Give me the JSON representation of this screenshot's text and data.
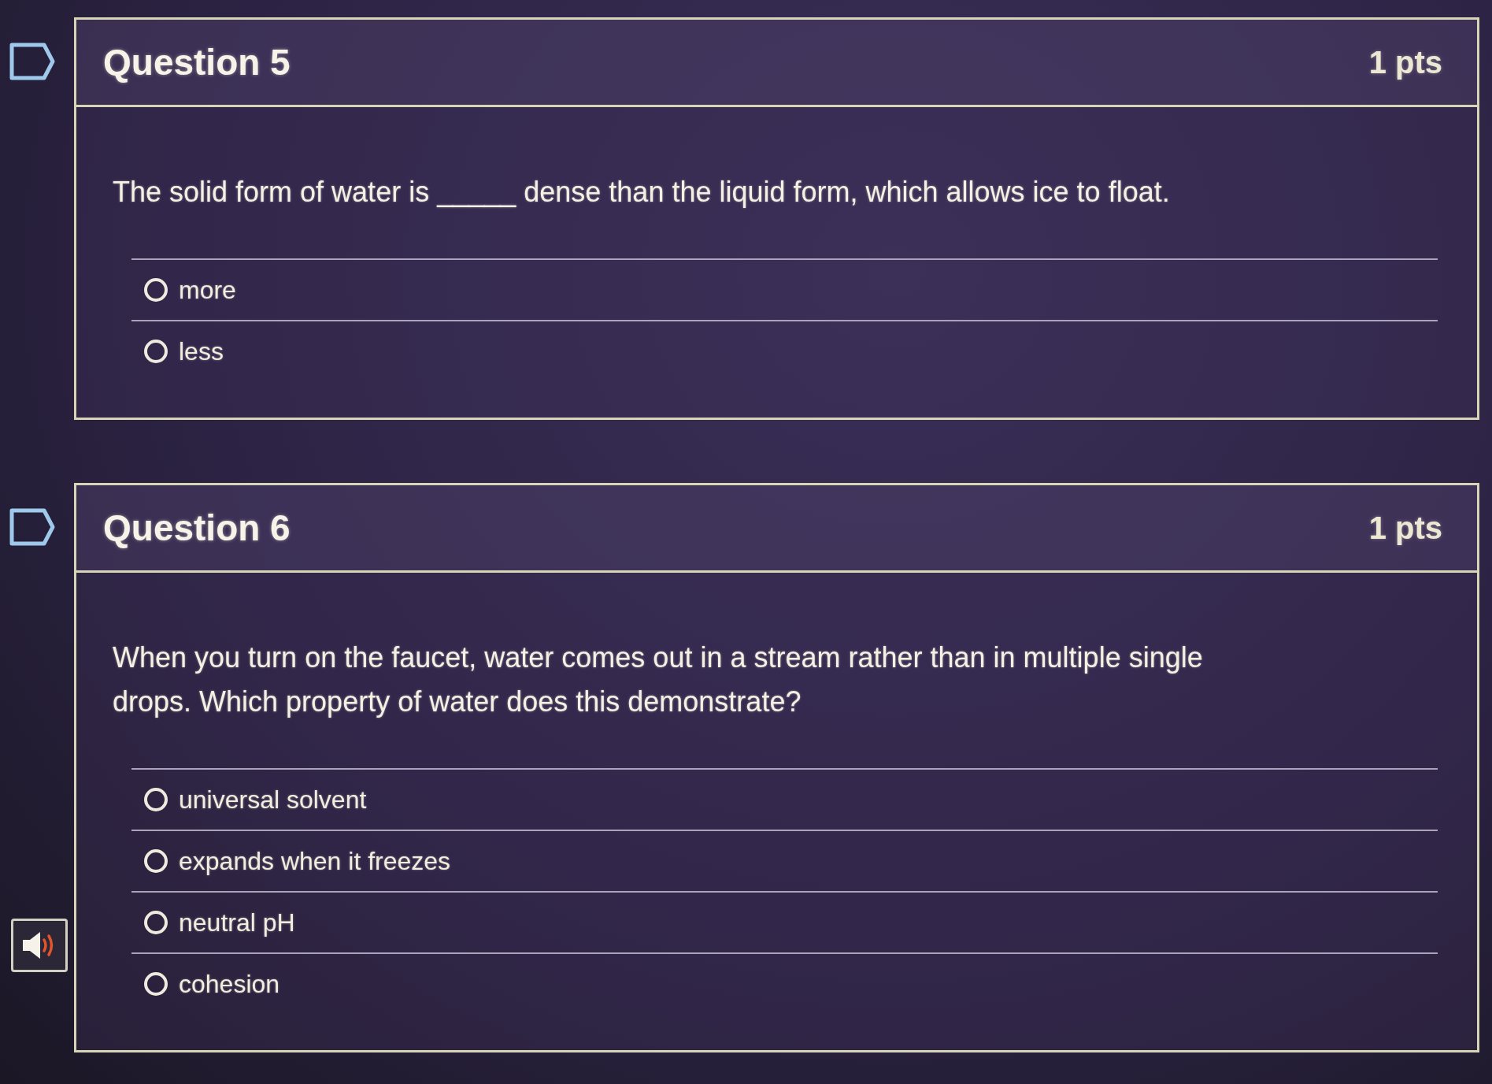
{
  "questions": [
    {
      "title": "Question 5",
      "points": "1 pts",
      "flagged": false,
      "prompt": "The solid form of water is _____ dense than the liquid form, which allows ice to float.",
      "options": [
        {
          "label": "more",
          "selected": false
        },
        {
          "label": "less",
          "selected": false
        }
      ]
    },
    {
      "title": "Question 6",
      "points": "1 pts",
      "flagged": false,
      "prompt": "When you turn on the faucet, water comes out in a stream rather than in multiple single drops. Which property of water does this demonstrate?",
      "options": [
        {
          "label": "universal solvent",
          "selected": false
        },
        {
          "label": "expands when it freezes",
          "selected": false
        },
        {
          "label": "neutral pH",
          "selected": false
        },
        {
          "label": "cohesion",
          "selected": false
        }
      ]
    }
  ]
}
